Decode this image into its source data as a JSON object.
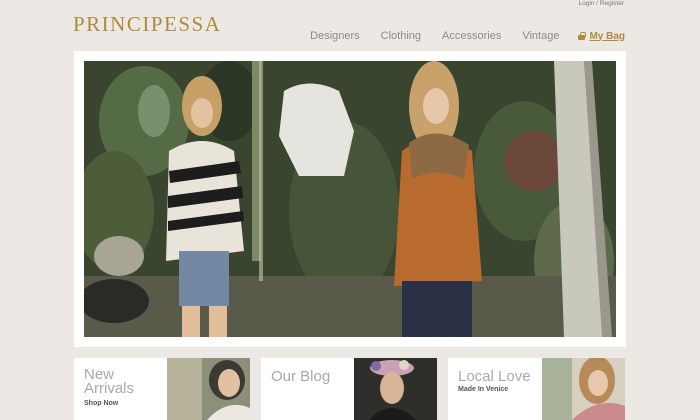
{
  "header": {
    "logo": "PRINCIPESSA",
    "login_register": "Login / Register",
    "nav": [
      "Designers",
      "Clothing",
      "Accessories",
      "Vintage"
    ],
    "bag_label": "My Bag"
  },
  "cards": [
    {
      "title_line1": "New",
      "title_line2": "Arrivals",
      "subtitle": "Shop Now"
    },
    {
      "title": "Our Blog"
    },
    {
      "title": "Local Love",
      "subtitle": "Made In Venice"
    }
  ],
  "colors": {
    "brand_gold": "#b08a3e",
    "background": "#ece9e4",
    "nav_text": "#8a8a8a"
  }
}
